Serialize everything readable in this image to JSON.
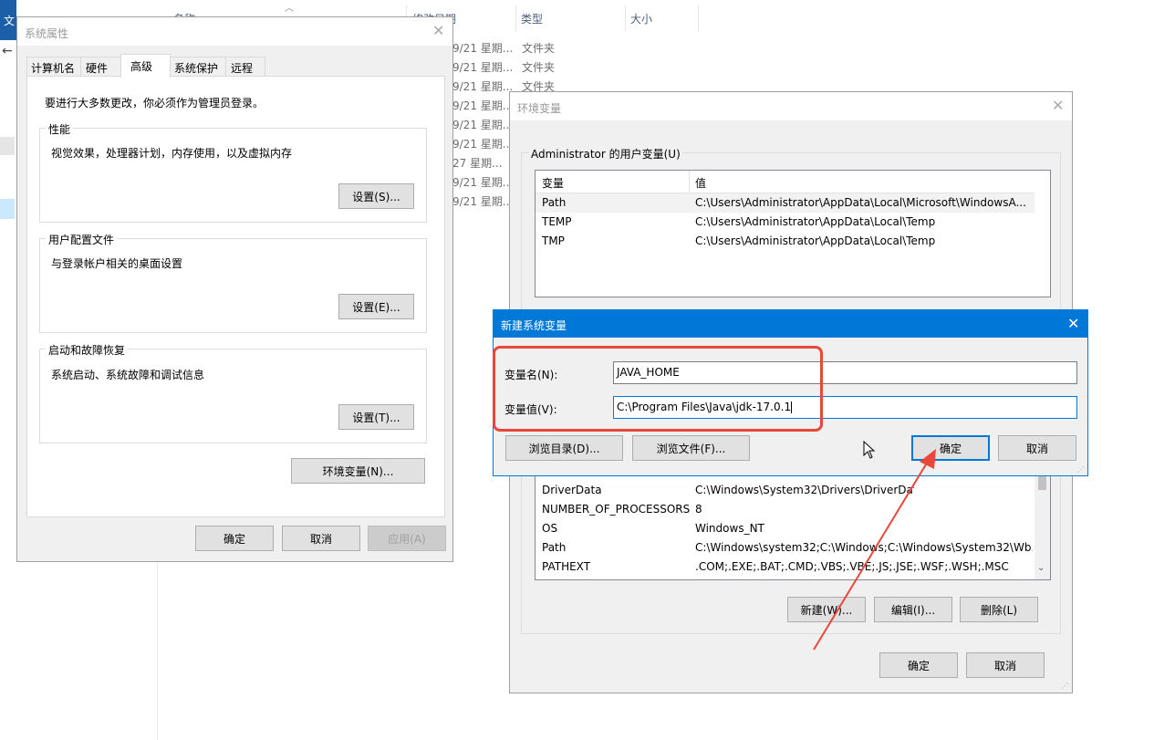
{
  "explorer": {
    "app_letter": "文",
    "headers": {
      "name": "名称",
      "modified": "修改日期",
      "type": "类型",
      "size": "大小"
    },
    "rows": [
      {
        "date": "9/21 星期...",
        "type": "文件夹"
      },
      {
        "date": "9/21 星期...",
        "type": "文件夹"
      },
      {
        "date": "9/21 星期...",
        "type": "文件夹"
      },
      {
        "date": "9/21 星期...",
        "type": ""
      },
      {
        "date": "9/21 星期...",
        "type": ""
      },
      {
        "date": "9/21 星期...",
        "type": ""
      },
      {
        "date": "27 星期...",
        "type": ""
      },
      {
        "date": "9/21 星期...",
        "type": ""
      },
      {
        "date": "9/21 星期...",
        "type": ""
      }
    ]
  },
  "sysprops": {
    "title": "系统属性",
    "tabs": [
      "计算机名",
      "硬件",
      "高级",
      "系统保护",
      "远程"
    ],
    "notice": "要进行大多数更改，你必须作为管理员登录。",
    "perf": {
      "title": "性能",
      "desc": "视觉效果，处理器计划，内存使用，以及虚拟内存",
      "button": "设置(S)..."
    },
    "profile": {
      "title": "用户配置文件",
      "desc": "与登录帐户相关的桌面设置",
      "button": "设置(E)..."
    },
    "startup": {
      "title": "启动和故障恢复",
      "desc": "系统启动、系统故障和调试信息",
      "button": "设置(T)..."
    },
    "env_button": "环境变量(N)...",
    "ok": "确定",
    "cancel": "取消",
    "apply": "应用(A)"
  },
  "envvars": {
    "title": "环境变量",
    "user_group_title": "Administrator 的用户变量(U)",
    "col_var": "变量",
    "col_val": "值",
    "user_rows": [
      {
        "name": "Path",
        "value": "C:\\Users\\Administrator\\AppData\\Local\\Microsoft\\WindowsA..."
      },
      {
        "name": "TEMP",
        "value": "C:\\Users\\Administrator\\AppData\\Local\\Temp"
      },
      {
        "name": "TMP",
        "value": "C:\\Users\\Administrator\\AppData\\Local\\Temp"
      }
    ],
    "sys_rows": [
      {
        "name": "DriverData",
        "value": "C:\\Windows\\System32\\Drivers\\DriverData"
      },
      {
        "name": "NUMBER_OF_PROCESSORS",
        "value": "8"
      },
      {
        "name": "OS",
        "value": "Windows_NT"
      },
      {
        "name": "Path",
        "value": "C:\\Windows\\system32;C:\\Windows;C:\\Windows\\System32\\Wb..."
      },
      {
        "name": "PATHEXT",
        "value": ".COM;.EXE;.BAT;.CMD;.VBS;.VBE;.JS;.JSE;.WSF;.WSH;.MSC"
      }
    ],
    "new_button": "新建(W)...",
    "edit_button": "编辑(I)...",
    "delete_button": "删除(L)",
    "ok": "确定",
    "cancel": "取消"
  },
  "newvar": {
    "title": "新建系统变量",
    "name_label": "变量名(N):",
    "name_value": "JAVA_HOME",
    "value_label": "变量值(V):",
    "value_value": "C:\\Program Files\\Java\\jdk-17.0.1",
    "browse_dir": "浏览目录(D)...",
    "browse_file": "浏览文件(F)...",
    "ok": "确定",
    "cancel": "取消"
  },
  "colors": {
    "highlight": "#e8473a",
    "accent": "#0078d7"
  }
}
